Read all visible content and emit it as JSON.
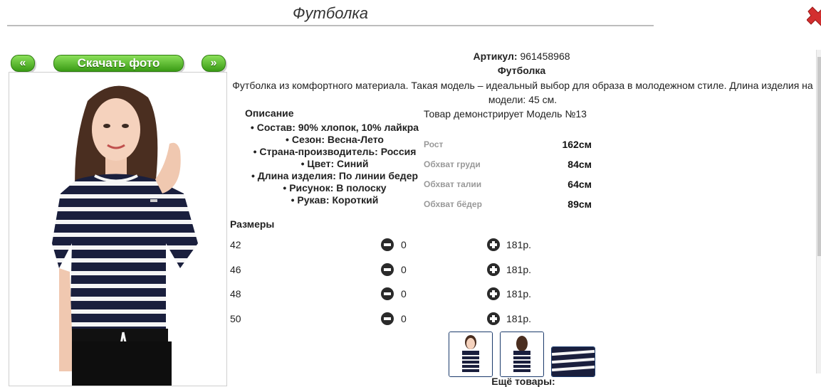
{
  "header": {
    "title": "Футболка"
  },
  "nav": {
    "prev_label": "«",
    "next_label": "»",
    "download_label": "Скачать фото"
  },
  "product": {
    "article_label": "Артикул:",
    "article_value": "961458968",
    "name": "Футболка",
    "description": "Футболка из комфортного материала. Такая модель – идеальный выбор для образа в молодежном стиле. Длина изделия на модели: 45 см."
  },
  "specs": {
    "heading": "Описание",
    "items": [
      "Состав: 90% хлопок, 10% лайкра",
      "Сезон: Весна-Лето",
      "Страна-производитель: Россия",
      "Цвет: Синий",
      "Длина изделия: По линии бедер",
      "Рисунок: В полоску",
      "Рукав: Короткий"
    ]
  },
  "model": {
    "title": "Товар демонстрирует Модель №13",
    "measurements": [
      {
        "label": "Рост",
        "value": "162см"
      },
      {
        "label": "Обхват груди",
        "value": "84см"
      },
      {
        "label": "Обхват талии",
        "value": "64см"
      },
      {
        "label": "Обхват бёдер",
        "value": "89см"
      }
    ]
  },
  "sizes": {
    "heading": "Размеры",
    "rows": [
      {
        "size": "42",
        "qty": "0",
        "price": "181р."
      },
      {
        "size": "46",
        "qty": "0",
        "price": "181р."
      },
      {
        "size": "48",
        "qty": "0",
        "price": "181р."
      },
      {
        "size": "50",
        "qty": "0",
        "price": "181р."
      }
    ]
  },
  "more": {
    "label": "Ещё товары:"
  },
  "colors": {
    "accent_green": "#4caf1f",
    "close_red": "#d32f2f",
    "stripe_navy": "#1a1f3d"
  }
}
